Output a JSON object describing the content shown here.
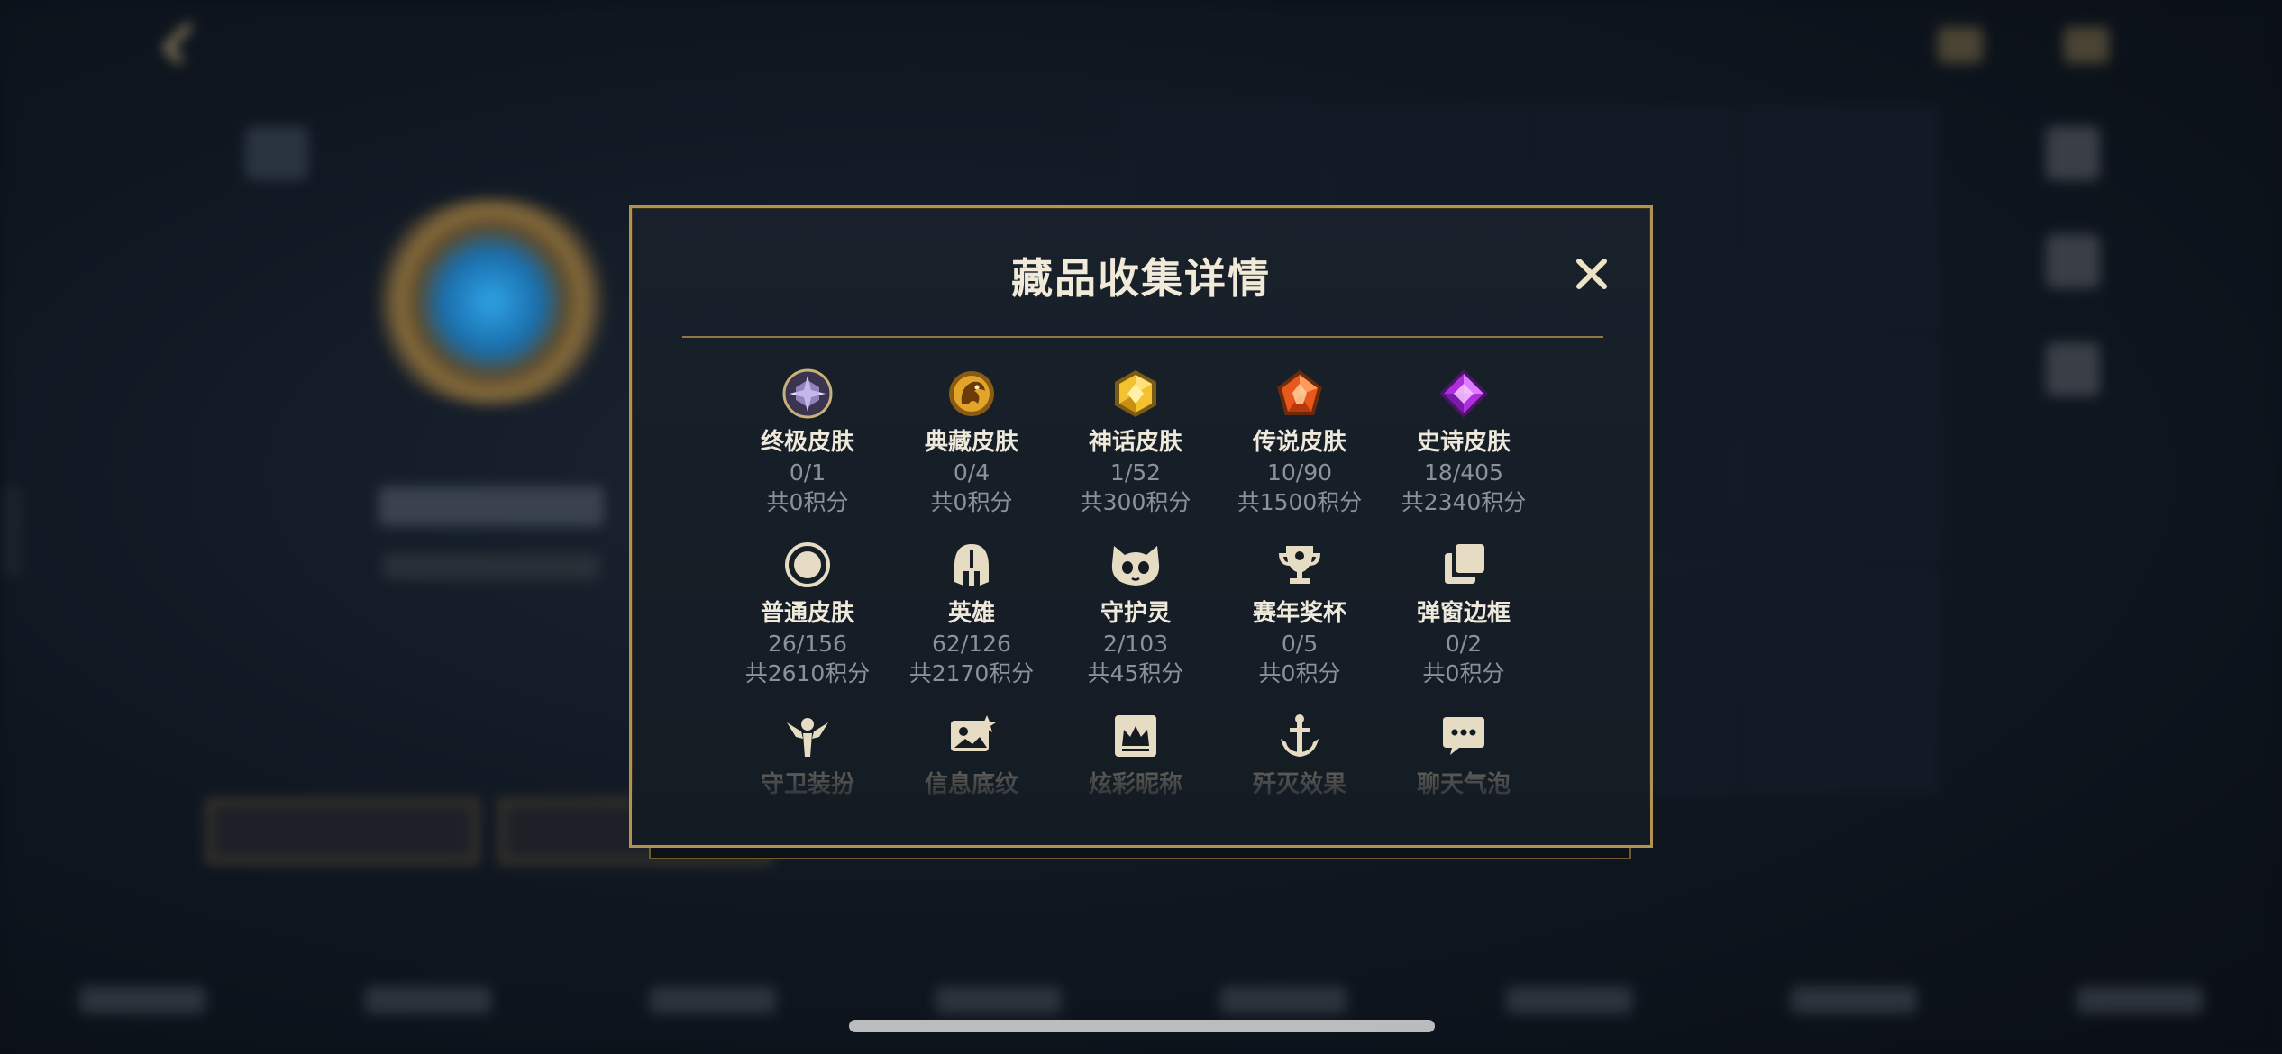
{
  "modal": {
    "title": "藏品收集详情",
    "close_icon": "close-icon"
  },
  "colors": {
    "gold_border": "#b29450",
    "title_text": "#f1ead8",
    "muted_text": "#8c929a"
  },
  "items": [
    {
      "label": "终极皮肤",
      "count": "0/1",
      "points": "共0积分",
      "icon": "ultimate-skin-gem-icon"
    },
    {
      "label": "典藏皮肤",
      "count": "0/4",
      "points": "共0积分",
      "icon": "legacy-skin-dragon-icon"
    },
    {
      "label": "神话皮肤",
      "count": "1/52",
      "points": "共300积分",
      "icon": "mythic-skin-gem-icon"
    },
    {
      "label": "传说皮肤",
      "count": "10/90",
      "points": "共1500积分",
      "icon": "legendary-skin-gem-icon"
    },
    {
      "label": "史诗皮肤",
      "count": "18/405",
      "points": "共2340积分",
      "icon": "epic-skin-gem-icon"
    },
    {
      "label": "普通皮肤",
      "count": "26/156",
      "points": "共2610积分",
      "icon": "normal-skin-circle-icon"
    },
    {
      "label": "英雄",
      "count": "62/126",
      "points": "共2170积分",
      "icon": "hero-helmet-icon"
    },
    {
      "label": "守护灵",
      "count": "2/103",
      "points": "共45积分",
      "icon": "guardian-pet-icon"
    },
    {
      "label": "赛年奖杯",
      "count": "0/5",
      "points": "共0积分",
      "icon": "trophy-icon"
    },
    {
      "label": "弹窗边框",
      "count": "0/2",
      "points": "共0积分",
      "icon": "popup-frame-icon"
    },
    {
      "label": "守卫装扮",
      "icon": "ward-skin-icon"
    },
    {
      "label": "信息底纹",
      "icon": "info-banner-icon"
    },
    {
      "label": "炫彩昵称",
      "icon": "colorful-nickname-icon"
    },
    {
      "label": "歼灭效果",
      "icon": "annihilation-effect-icon"
    },
    {
      "label": "聊天气泡",
      "icon": "chat-bubble-icon"
    }
  ]
}
